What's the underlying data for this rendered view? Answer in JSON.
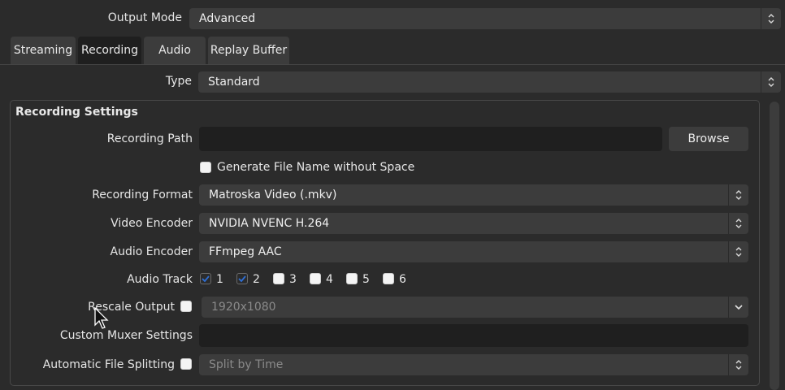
{
  "output_mode": {
    "label": "Output Mode",
    "value": "Advanced"
  },
  "tabs": [
    {
      "label": "Streaming",
      "active": false
    },
    {
      "label": "Recording",
      "active": true
    },
    {
      "label": "Audio",
      "active": false
    },
    {
      "label": "Replay Buffer",
      "active": false
    }
  ],
  "type": {
    "label": "Type",
    "value": "Standard"
  },
  "group_title": "Recording Settings",
  "recording_path": {
    "label": "Recording Path",
    "value": "",
    "browse_label": "Browse"
  },
  "generate_filename": {
    "label": "Generate File Name without Space",
    "checked": false
  },
  "recording_format": {
    "label": "Recording Format",
    "value": "Matroska Video (.mkv)"
  },
  "video_encoder": {
    "label": "Video Encoder",
    "value": "NVIDIA NVENC H.264"
  },
  "audio_encoder": {
    "label": "Audio Encoder",
    "value": "FFmpeg AAC"
  },
  "audio_track": {
    "label": "Audio Track",
    "tracks": [
      {
        "label": "1",
        "checked": true
      },
      {
        "label": "2",
        "checked": true
      },
      {
        "label": "3",
        "checked": false
      },
      {
        "label": "4",
        "checked": false
      },
      {
        "label": "5",
        "checked": false
      },
      {
        "label": "6",
        "checked": false
      }
    ]
  },
  "rescale_output": {
    "label": "Rescale Output",
    "checked": false,
    "value": "1920x1080"
  },
  "custom_muxer": {
    "label": "Custom Muxer Settings",
    "value": ""
  },
  "auto_split": {
    "label": "Automatic File Splitting",
    "checked": false,
    "value": "Split by Time"
  },
  "colors": {
    "background": "#2b2b2b",
    "control": "#3c3c3c",
    "field": "#1f1f1f",
    "accent": "#2e6fd6"
  }
}
